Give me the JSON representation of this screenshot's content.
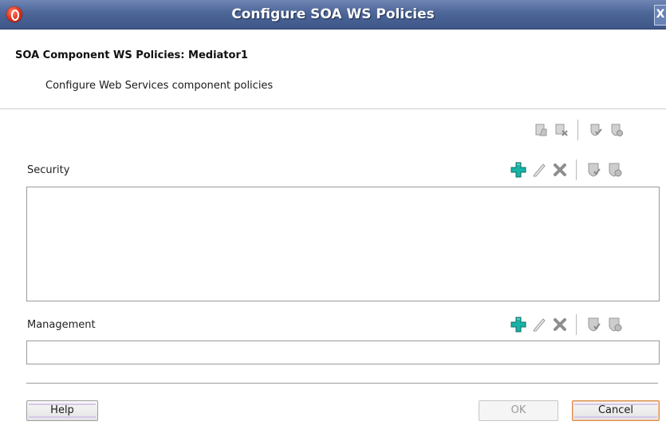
{
  "window": {
    "title": "Configure SOA WS Policies",
    "close_label": "X"
  },
  "header": {
    "subtitle": "SOA Component WS Policies: Mediator1",
    "description": "Configure Web Services component policies"
  },
  "top_toolbar": {
    "icons": [
      "attach-policy-icon",
      "detach-policy-icon",
      "enable-policy-icon",
      "disable-policy-icon"
    ]
  },
  "security": {
    "label": "Security",
    "items": [],
    "toolbar": [
      "add-icon",
      "edit-icon",
      "delete-icon",
      "enable-shield-icon",
      "disable-shield-icon"
    ]
  },
  "management": {
    "label": "Management",
    "items": [],
    "toolbar": [
      "add-icon",
      "edit-icon",
      "delete-icon",
      "enable-shield-icon",
      "disable-shield-icon"
    ]
  },
  "footer": {
    "help_label": "Help",
    "ok_label": "OK",
    "cancel_label": "Cancel"
  },
  "colors": {
    "titlebar": "#4d6698",
    "add_icon": "#18a9a0",
    "cancel_focus": "#d98a4e"
  }
}
